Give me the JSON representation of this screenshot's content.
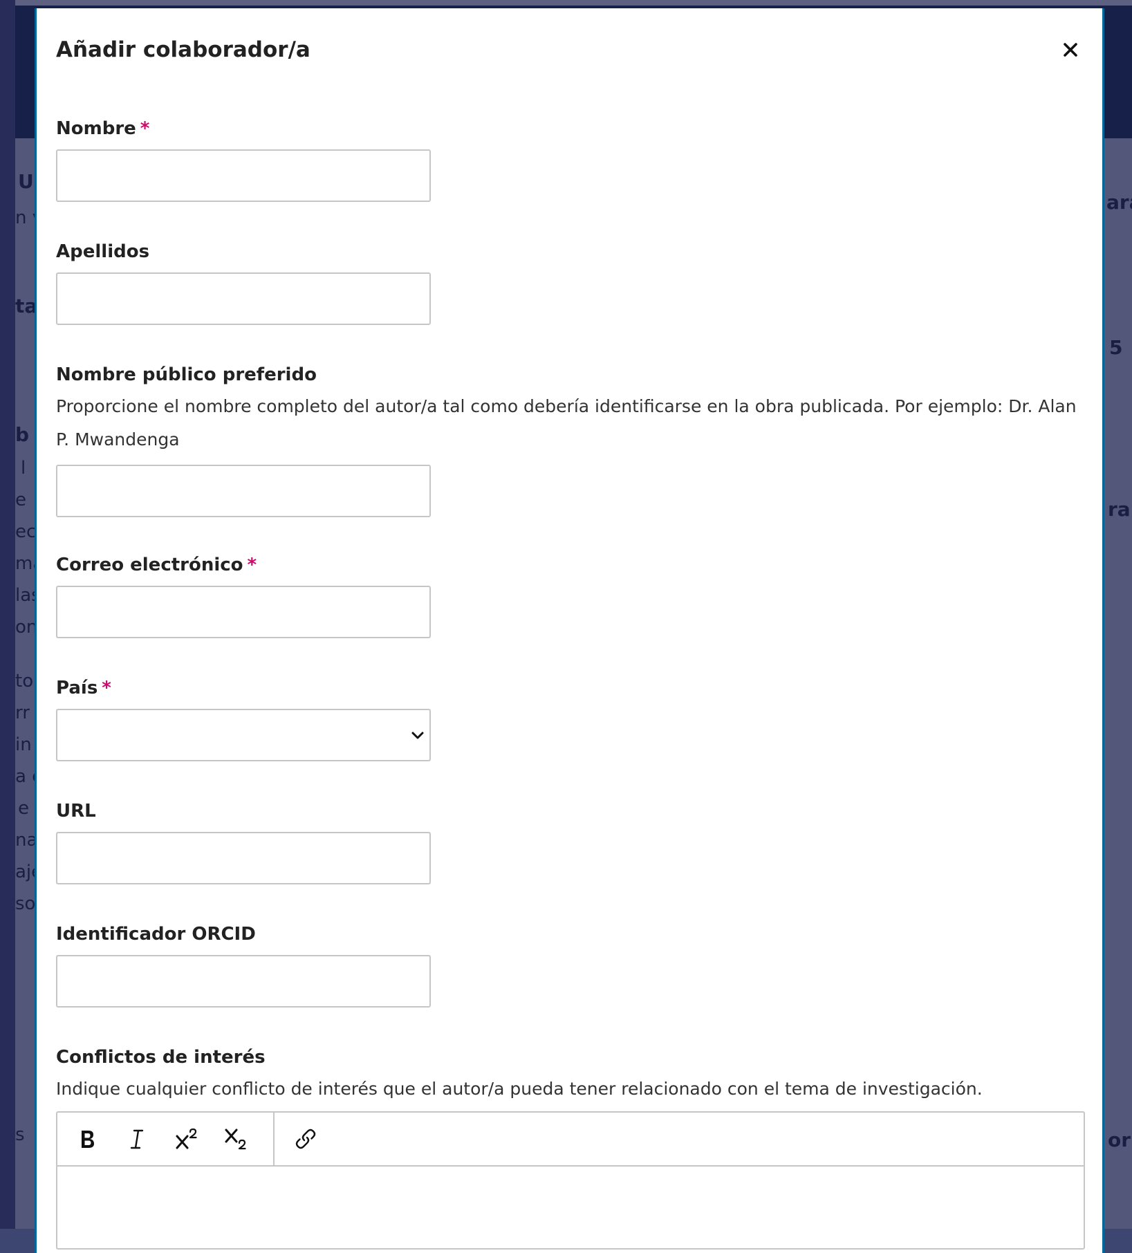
{
  "background": {
    "fragments": [
      "U",
      "n v",
      "ta",
      "b",
      "l",
      "e",
      "ec",
      "ma",
      "las",
      "on",
      "tol",
      "rr",
      "in",
      "a c",
      "e",
      "na",
      "aje",
      "so",
      "s",
      "ara",
      "5",
      "ra",
      "or"
    ]
  },
  "modal": {
    "title": "Añadir colaborador/a",
    "close_icon": "close-icon"
  },
  "form": {
    "first_name": {
      "label": "Nombre",
      "required_mark": "*",
      "value": ""
    },
    "last_name": {
      "label": "Apellidos",
      "value": ""
    },
    "preferred_public_name": {
      "label": "Nombre público preferido",
      "description": "Proporcione el nombre completo del autor/a tal como debería identificarse en la obra publicada. Por ejemplo: Dr. Alan P. Mwandenga",
      "value": ""
    },
    "email": {
      "label": "Correo electrónico",
      "required_mark": "*",
      "value": ""
    },
    "country": {
      "label": "País",
      "required_mark": "*",
      "selected": ""
    },
    "url": {
      "label": "URL",
      "value": ""
    },
    "orcid": {
      "label": "Identificador ORCID",
      "value": ""
    },
    "competing_interests": {
      "label": "Conflictos de interés",
      "description": "Indique cualquier conflicto de interés que el autor/a pueda tener relacionado con el tema de investigación.",
      "toolbar": [
        "bold-icon",
        "italic-icon",
        "superscript-icon",
        "subscript-icon",
        "link-icon"
      ]
    }
  },
  "colors": {
    "accent": "#006798",
    "required": "#d00a6c",
    "overlay": "#3d4670",
    "header": "#001a33"
  }
}
